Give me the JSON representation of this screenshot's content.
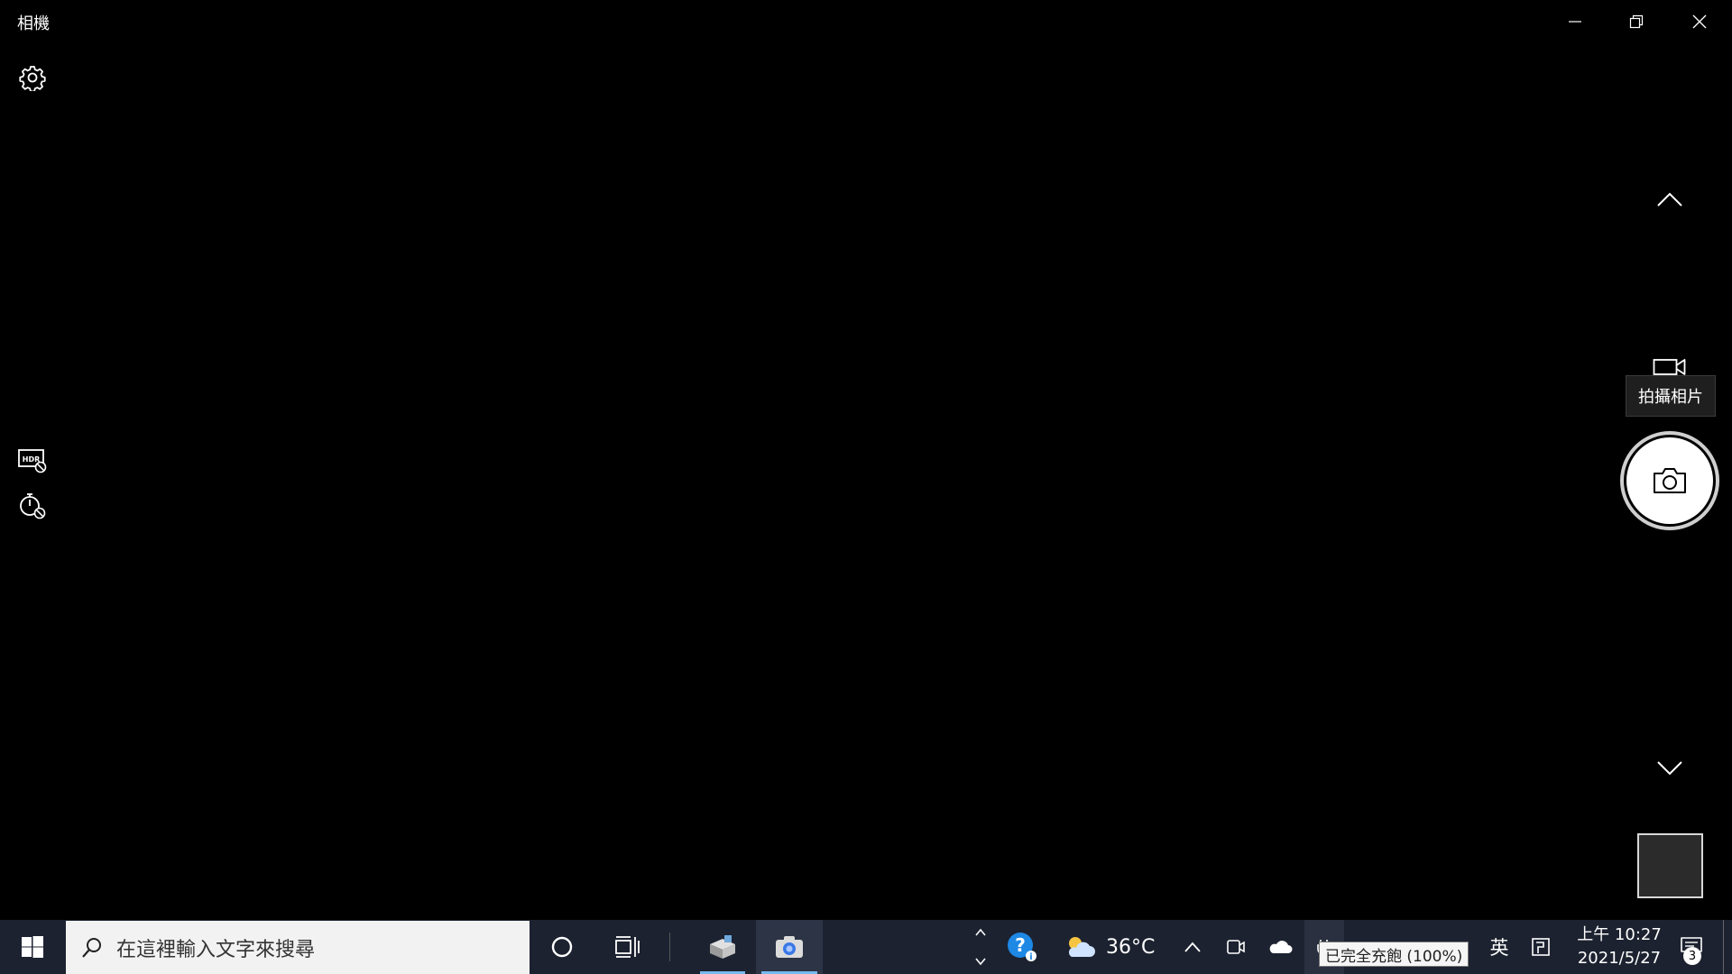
{
  "window": {
    "title": "相機",
    "minimize_icon": "minimize-icon",
    "restore_icon": "restore-icon",
    "close_icon": "close-icon"
  },
  "left_toolbar": {
    "settings_icon": "gear-icon",
    "hdr_icon": "hdr-off-icon",
    "timer_icon": "timer-off-icon"
  },
  "right_panel": {
    "up_icon": "chevron-up-icon",
    "video_mode_icon": "video-camera-icon",
    "tooltip": "拍攝相片",
    "shutter_icon": "camera-icon",
    "down_icon": "chevron-down-icon"
  },
  "taskbar": {
    "search_placeholder": "在這裡輸入文字來搜尋",
    "weather_temp": "36°C",
    "language": "英",
    "clock_time": "上午 10:27",
    "clock_date": "2021/5/27",
    "battery_tooltip": "已完全充飽 (100%)",
    "notification_count": "3",
    "accent_color": "#76b9ed"
  }
}
